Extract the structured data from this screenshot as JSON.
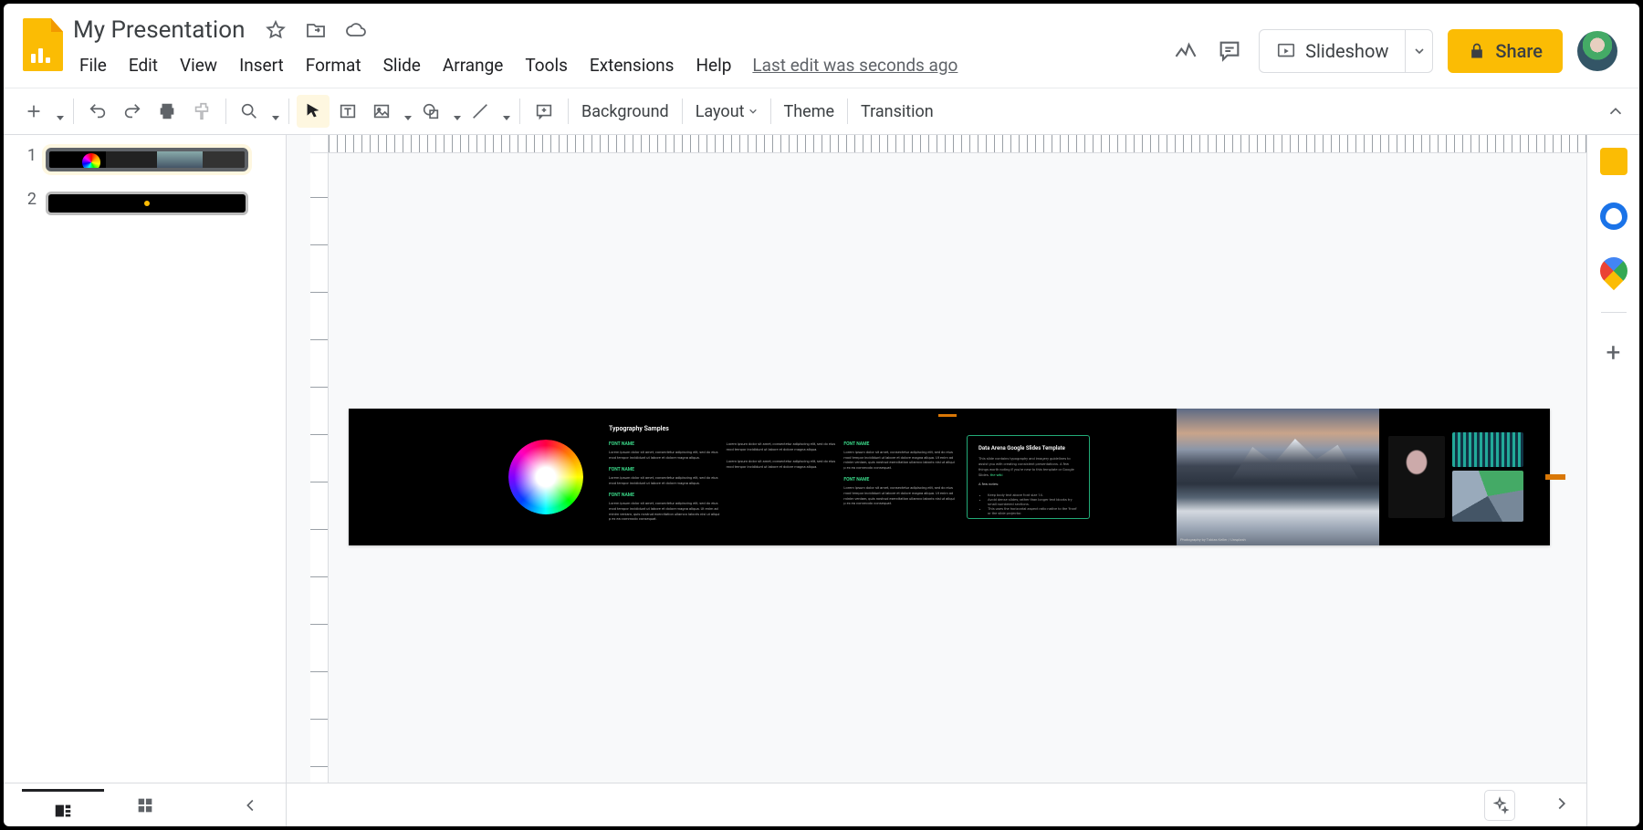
{
  "document": {
    "title": "My Presentation",
    "status": "Last edit was seconds ago"
  },
  "menu": [
    "File",
    "Edit",
    "View",
    "Insert",
    "Format",
    "Slide",
    "Arrange",
    "Tools",
    "Extensions",
    "Help"
  ],
  "header_buttons": {
    "slideshow": "Slideshow",
    "share": "Share"
  },
  "toolbar": {
    "background": "Background",
    "layout": "Layout",
    "theme": "Theme",
    "transition": "Transition"
  },
  "slides": [
    {
      "number": "1",
      "selected": true
    },
    {
      "number": "2",
      "selected": false
    }
  ],
  "slide_content": {
    "typo_title": "Typography Samples",
    "col_label_1": "FONT NAME",
    "col_label_2": "FONT NAME",
    "col_label_3": "FONT NAME",
    "col_label_4": "FONT NAME",
    "col_label_5": "FONT NAME",
    "lorem_short": "Lorem ipsum dolor sit amet, consectetur adipiscing elit, sed do eiusmod tempor incididunt ut labore et dolore magna aliqua.",
    "lorem_long": "Lorem ipsum dolor sit amet, consectetur adipiscing elit, sed do eiusmod tempor incididunt ut labore et dolore magna aliqua. Ut enim ad minim veniam, quis nostrud exercitation ullamco laboris nisi ut aliquip ex ea commodo consequat.",
    "card_title": "Data Arena Google Slides Template",
    "card_body": "This slide contains typography and imagery guidelines to assist you with creating consistent presentations. A few things worth noting if you're new to this template or Google Slides.",
    "card_link_text": "the wiki",
    "card_notes_title": "A few notes:",
    "card_bullets": [
      "Keep body text above font size 14.",
      "Avoid dense slides; rather than longer text blocks try small numbered sections.",
      "This uses the horizontal aspect ratio native to the 'front' or the slide projector."
    ],
    "mountain_caption": "Photography by Tobias Keller / Unsplash"
  }
}
